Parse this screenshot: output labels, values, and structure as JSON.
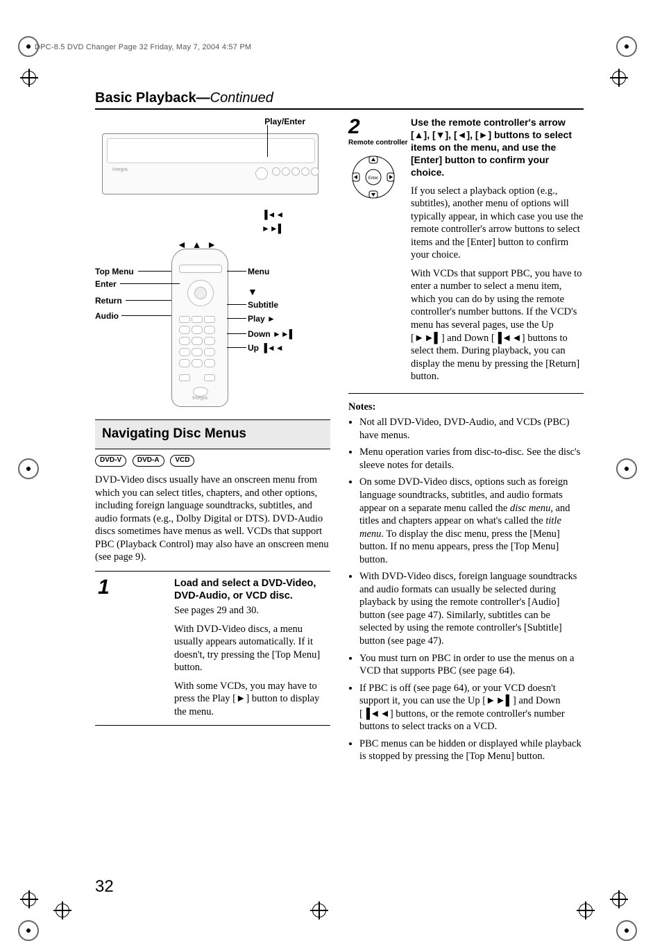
{
  "header_line": "DPC-8.5 DVD Changer  Page 32  Friday, May 7, 2004  4:57 PM",
  "title_main": "Basic Playback",
  "title_dash": "—",
  "title_cont": "Continued",
  "page_number": "32",
  "diag": {
    "play_enter": "Play/Enter",
    "top_menu": "Top Menu",
    "enter": "Enter",
    "return": "Return",
    "audio": "Audio",
    "menu": "Menu",
    "subtitle": "Subtitle",
    "play": "Play ",
    "down": "Down ",
    "up": "Up "
  },
  "sub_heading": "Navigating Disc Menus",
  "badges": [
    "DVD-V",
    "DVD-A",
    "VCD"
  ],
  "intro": "DVD-Video discs usually have an onscreen menu from which you can select titles, chapters, and other options, including foreign language soundtracks, subtitles, and audio formats (e.g., Dolby Digital or DTS). DVD-Audio discs sometimes have menus as well. VCDs that support PBC (Playback Control) may also have an onscreen menu (see page 9).",
  "step1": {
    "num": "1",
    "bold": "Load and select a DVD-Video, DVD-Audio, or VCD disc.",
    "l1": "See pages 29 and 30.",
    "l2": "With DVD-Video discs, a menu usually appears automatically. If it doesn't, try pressing the [Top Menu] button.",
    "l3a": "With some VCDs, you may have to press the Play [",
    "l3b": "] button to display the menu."
  },
  "step2": {
    "num": "2",
    "rc": "Remote controller",
    "bold_a": "Use the remote controller's arrow [",
    "bold_b": "], [",
    "bold_c": "], [",
    "bold_d": "], [",
    "bold_e": "] buttons to select items on the menu, and use the [Enter] button to confirm your choice.",
    "p1": "If you select a playback option (e.g., subtitles), another menu of options will typically appear, in which case you use the remote controller's arrow buttons to select items and the [Enter] button to confirm your choice.",
    "p2a": "With VCDs that support PBC, you have to enter a number to select a menu item, which you can do by using the remote controller's number buttons. If the VCD's menu has several pages, use the Up [",
    "p2b": "] and Down [",
    "p2c": "] buttons to select them. During playback, you can display the menu by pressing the [Return] button."
  },
  "notes_head": "Notes:",
  "notes": {
    "n1": "Not all DVD-Video, DVD-Audio, and VCDs (PBC) have menus.",
    "n2": "Menu operation varies from disc-to-disc. See the disc's sleeve notes for details.",
    "n3a": "On some DVD-Video discs, options such as foreign language soundtracks, subtitles, and audio formats appear on a separate menu called the ",
    "n3b": "disc menu,",
    "n3c": " and titles and chapters appear on what's called the ",
    "n3d": "title menu",
    "n3e": ". To display the disc menu, press the [Menu] button. If no menu appears, press the [Top Menu] button.",
    "n4": "With DVD-Video discs, foreign language soundtracks and audio formats can usually be selected during playback by using the remote controller's [Audio] button (see page 47). Similarly, subtitles can be selected by using the remote controller's [Subtitle] button (see page 47).",
    "n5": "You must turn on PBC in order to use the menus on a VCD that supports PBC (see page 64).",
    "n6a": "If PBC is off (see page 64), or your VCD doesn't support it, you can use the Up [",
    "n6b": "] and Down [",
    "n6c": "] buttons, or the remote controller's number buttons to select tracks on a VCD.",
    "n7": "PBC menus can be hidden or displayed while playback is stopped by pressing the [Top Menu] button."
  }
}
